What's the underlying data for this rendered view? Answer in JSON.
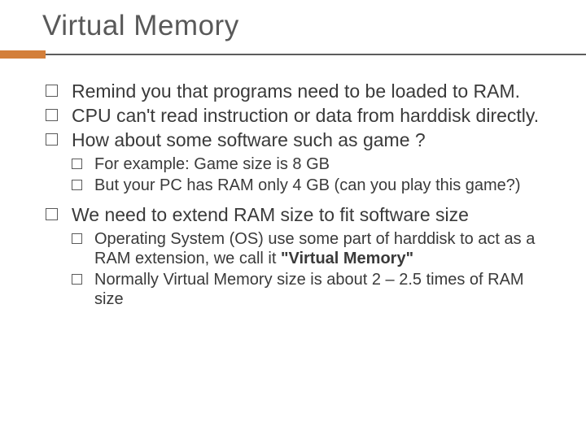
{
  "title": "Virtual Memory",
  "bullets": {
    "b0": "Remind you that programs need to be loaded to RAM.",
    "b1": "CPU can't read instruction or data from harddisk directly.",
    "b2": "How about some software such as game ?",
    "b2_sub": {
      "s0": "For example: Game size is 8 GB",
      "s1": "But your PC has RAM only 4 GB (can you play this game?)"
    },
    "b3": "We need to extend RAM size to fit software size",
    "b3_sub": {
      "s0_pre": "Operating System (OS) use some part of harddisk to act as a RAM extension, we call it ",
      "s0_vm": "\"Virtual Memory\"",
      "s1": "Normally Virtual Memory size is about 2 – 2.5 times of RAM size"
    }
  }
}
